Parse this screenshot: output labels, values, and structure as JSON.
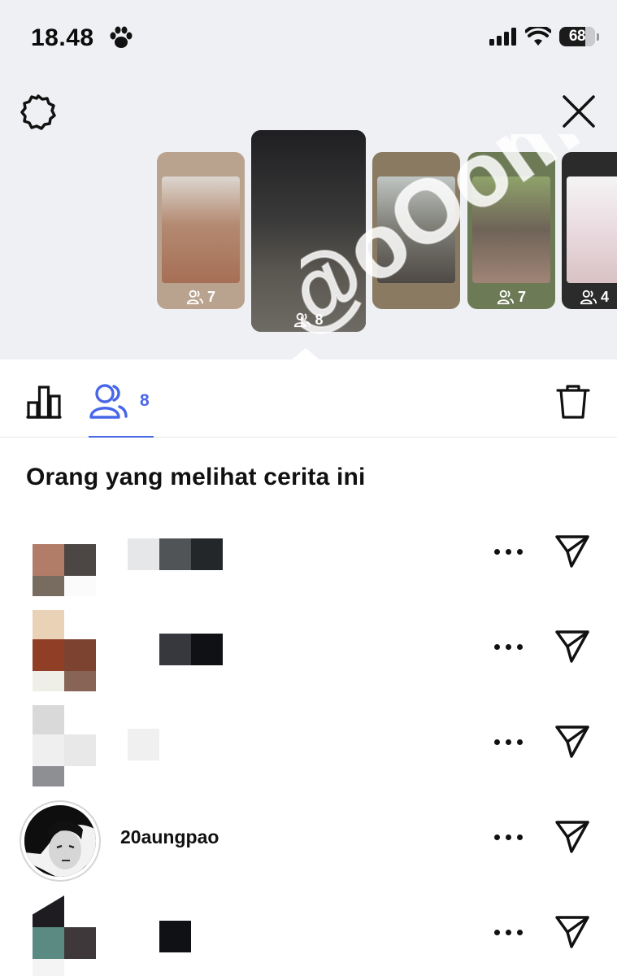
{
  "status_bar": {
    "time": "18.48",
    "battery": "68"
  },
  "stories": [
    {
      "viewers": "7"
    },
    {
      "viewers": "8"
    },
    {
      "viewers": ""
    },
    {
      "viewers": "7"
    },
    {
      "viewers": "4"
    }
  ],
  "tabs": {
    "viewers_count": "8"
  },
  "section_title": "Orang yang melihat cerita ini",
  "viewers": [
    {
      "username": ""
    },
    {
      "username": ""
    },
    {
      "username": ""
    },
    {
      "username": "20aungpao"
    },
    {
      "username": ""
    }
  ],
  "watermark": "@oOom",
  "colors": {
    "accent": "#4766e8",
    "top_background": "#eef0f3"
  }
}
